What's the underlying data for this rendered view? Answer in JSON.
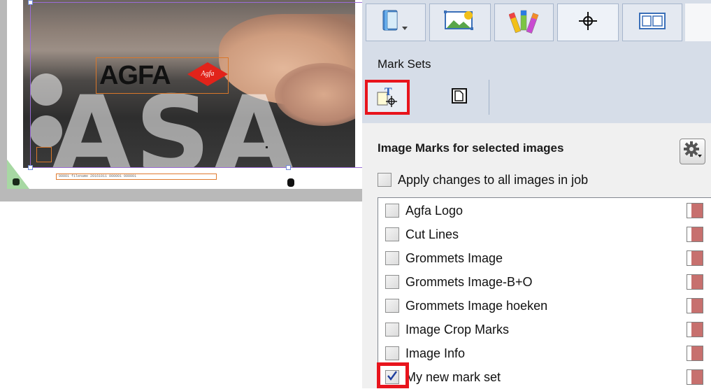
{
  "preview": {
    "logo_text": "AGFA",
    "logo_badge": "Agfa",
    "background_text": "ASA",
    "info_line": "00001 filename 20161011 000001 000001"
  },
  "panel": {
    "tabs": [
      {
        "icon": "book-icon",
        "active": false
      },
      {
        "icon": "image-icon",
        "active": false
      },
      {
        "icon": "color-swatches-icon",
        "active": false
      },
      {
        "icon": "crosshair-icon",
        "active": true
      },
      {
        "icon": "layout-icon",
        "active": false
      }
    ],
    "mark_sets_title": "Mark Sets",
    "subtabs": [
      {
        "icon": "text-marks-icon",
        "selected": true
      },
      {
        "icon": "page-marks-icon",
        "selected": false
      }
    ],
    "section_heading": "Image Marks for selected images",
    "apply_all": {
      "label": "Apply changes to all images in job",
      "checked": false
    },
    "mark_sets": [
      {
        "label": "Agfa Logo",
        "checked": false
      },
      {
        "label": "Cut Lines",
        "checked": false
      },
      {
        "label": "Grommets Image",
        "checked": false
      },
      {
        "label": "Grommets Image-B+O",
        "checked": false
      },
      {
        "label": "Grommets Image hoeken",
        "checked": false
      },
      {
        "label": "Image Crop Marks",
        "checked": false
      },
      {
        "label": "Image Info",
        "checked": false
      },
      {
        "label": "My new mark set",
        "checked": true
      }
    ],
    "colors": {
      "highlight": "#e8141c",
      "swatch": "#c7706e",
      "tabbar": "#d6dde8"
    }
  }
}
